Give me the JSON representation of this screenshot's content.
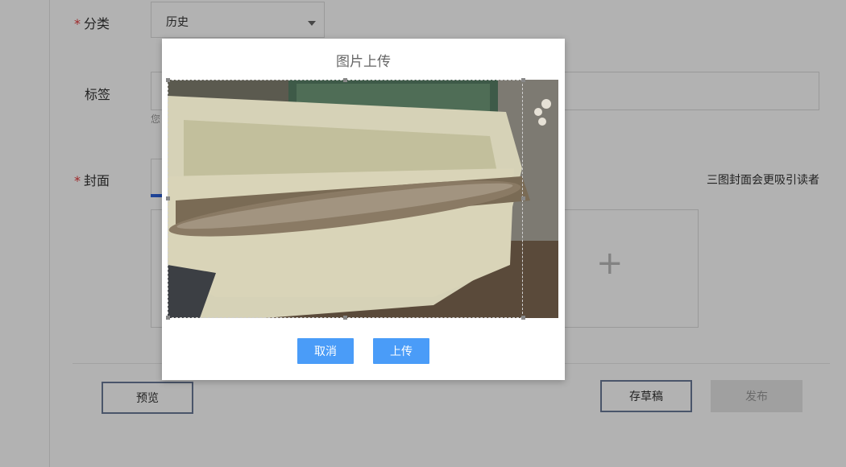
{
  "form": {
    "category_label": "分类",
    "category_value": "历史",
    "tags_label": "标签",
    "tags_hint": "您",
    "cover_label": "封面",
    "cover_tip": "三图封面会更吸引读者",
    "required_mark": "*"
  },
  "footer": {
    "preview_label": "预览",
    "save_draft_label": "存草稿",
    "publish_label": "发布"
  },
  "modal": {
    "title": "图片上传",
    "cancel_label": "取消",
    "upload_label": "上传"
  },
  "icons": {
    "upload_plus": "+",
    "select_caret": "chevron-down-icon"
  },
  "colors": {
    "primary": "#4a9cf8",
    "required": "#e4393c",
    "tab_active": "#2d62d8"
  }
}
